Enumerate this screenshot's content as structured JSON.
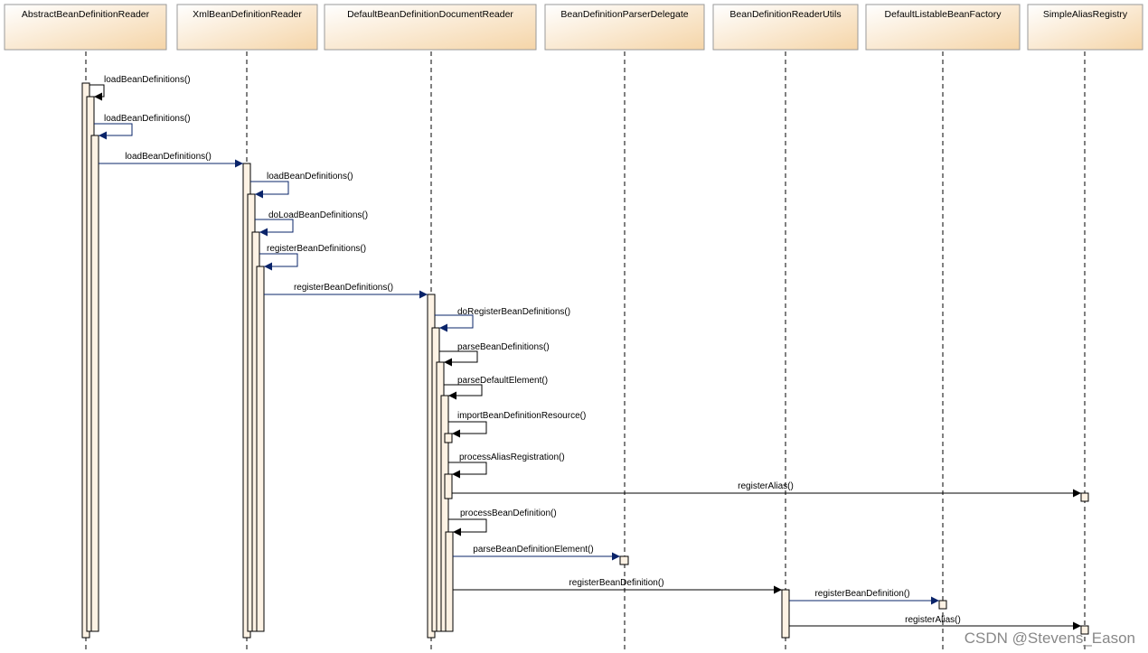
{
  "participants": [
    "AbstractBeanDefinitionReader",
    "XmlBeanDefinitionReader",
    "DefaultBeanDefinitionDocumentReader",
    "BeanDefinitionParserDelegate",
    "BeanDefinitionReaderUtils",
    "DefaultListableBeanFactory",
    "SimpleAliasRegistry"
  ],
  "messages": [
    {
      "label": "loadBeanDefinitions()",
      "from": 0,
      "to": 0,
      "color": "#000000"
    },
    {
      "label": "loadBeanDefinitions()",
      "from": 0,
      "to": 0,
      "color": "#0a246a"
    },
    {
      "label": "loadBeanDefinitions()",
      "from": 0,
      "to": 1,
      "color": "#0a246a"
    },
    {
      "label": "loadBeanDefinitions()",
      "from": 1,
      "to": 1,
      "color": "#0a246a"
    },
    {
      "label": "doLoadBeanDefinitions()",
      "from": 1,
      "to": 1,
      "color": "#0a246a"
    },
    {
      "label": "registerBeanDefinitions()",
      "from": 1,
      "to": 1,
      "color": "#0a246a"
    },
    {
      "label": "registerBeanDefinitions()",
      "from": 1,
      "to": 2,
      "color": "#0a246a"
    },
    {
      "label": "doRegisterBeanDefinitions()",
      "from": 2,
      "to": 2,
      "color": "#0a246a"
    },
    {
      "label": "parseBeanDefinitions()",
      "from": 2,
      "to": 2,
      "color": "#000000"
    },
    {
      "label": "parseDefaultElement()",
      "from": 2,
      "to": 2,
      "color": "#000000"
    },
    {
      "label": "importBeanDefinitionResource()",
      "from": 2,
      "to": 2,
      "color": "#000000"
    },
    {
      "label": "processAliasRegistration()",
      "from": 2,
      "to": 2,
      "color": "#000000"
    },
    {
      "label": "registerAlias()",
      "from": 2,
      "to": 6,
      "color": "#000000"
    },
    {
      "label": "processBeanDefinition()",
      "from": 2,
      "to": 2,
      "color": "#000000"
    },
    {
      "label": "parseBeanDefinitionElement()",
      "from": 2,
      "to": 3,
      "color": "#0a246a"
    },
    {
      "label": "registerBeanDefinition()",
      "from": 2,
      "to": 4,
      "color": "#000000"
    },
    {
      "label": "registerBeanDefinition()",
      "from": 4,
      "to": 5,
      "color": "#0a246a"
    },
    {
      "label": "registerAlias()",
      "from": 4,
      "to": 6,
      "color": "#000000"
    }
  ],
  "colors": {
    "header_fill_top": "#ffffff",
    "header_fill_bottom": "#f7d9b0",
    "activation_fill": "#fdf2e4",
    "call_blue": "#0a246a",
    "call_black": "#000000"
  },
  "watermark": "CSDN @Stevens_Eason"
}
